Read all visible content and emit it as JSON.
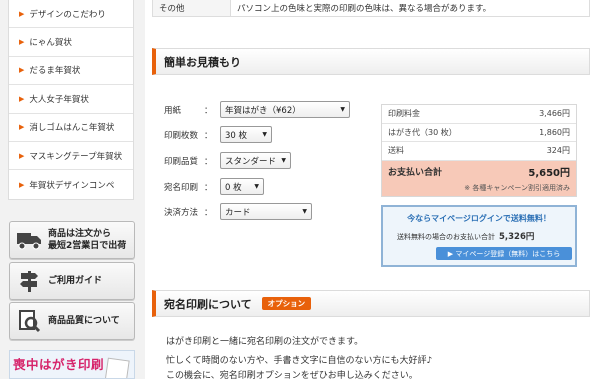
{
  "sidebar": {
    "items": [
      {
        "label": "デザインのこだわり"
      },
      {
        "label": "にゃん賀状"
      },
      {
        "label": "だるま年賀状"
      },
      {
        "label": "大人女子年賀状"
      },
      {
        "label": "消しゴムはんこ年賀状"
      },
      {
        "label": "マスキングテープ年賀状"
      },
      {
        "label": "年賀状デザインコンペ"
      }
    ],
    "buttons": [
      {
        "line1": "商品は注文から",
        "line2": "最短2営業日で出荷",
        "icon": "truck-icon"
      },
      {
        "line1": "ご利用ガイド",
        "line2": "",
        "icon": "signpost-icon"
      },
      {
        "line1": "商品品質について",
        "line2": "",
        "icon": "magnifier-icon"
      }
    ],
    "banner_text": "喪中はがき印刷"
  },
  "other_row": {
    "label": "その他",
    "value": "パソコン上の色味と実際の印刷の色味は、異なる場合があります。"
  },
  "estimate": {
    "title": "簡単お見積もり",
    "fields": [
      {
        "label": "用紙",
        "value": "年賀はがき（¥62）"
      },
      {
        "label": "印刷枚数",
        "value": "30 枚"
      },
      {
        "label": "印刷品質",
        "value": "スタンダード"
      },
      {
        "label": "宛名印刷",
        "value": "0 枚"
      },
      {
        "label": "決済方法",
        "value": "カード"
      }
    ],
    "colon": "：",
    "summary": {
      "rows": [
        {
          "label": "印刷料金",
          "value": "3,466円"
        },
        {
          "label": "はがき代（30 枚）",
          "value": "1,860円"
        },
        {
          "label": "送料",
          "value": "324円"
        }
      ],
      "total_label": "お支払い合計",
      "total_value": "5,650円",
      "note": "※ 各種キャンペーン割引適用済み"
    },
    "mypage": {
      "headline": "今ならマイページログインで送料無料！",
      "sub_label": "送料無料の場合のお支払い合計",
      "sub_value": "5,326円",
      "button": "▶ マイページ登録（無料）はこちら"
    }
  },
  "address_section": {
    "title": "宛名印刷について",
    "badge": "オプション",
    "lines": [
      "はがき印刷と一緒に宛名印刷の注文ができます。",
      "忙しくて時間のない方や、手書き文字に自信のない方にも大好評♪",
      "この機会に、宛名印刷オプションをぜひお申し込みください。"
    ]
  },
  "colors": {
    "accent": "#e8610b",
    "total_bg": "#f7c9b8",
    "link_blue": "#2a6fb5",
    "banner_pink": "#d6236a"
  }
}
